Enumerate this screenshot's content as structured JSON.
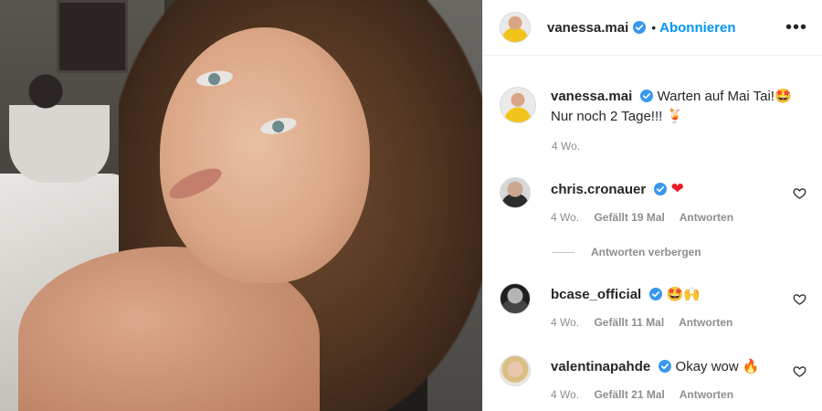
{
  "post": {
    "author": "vanessa.mai",
    "follow_label": "Abonnieren",
    "more_label": "•••",
    "caption_text_line1": "Warten auf Mai Tai!",
    "caption_emoji1": "🤩",
    "caption_text_line2": "Nur noch 2 Tage!!!",
    "caption_emoji2": "🍹",
    "caption_age": "4 Wo."
  },
  "comments": [
    {
      "user": "chris.cronauer",
      "text": "",
      "emoji": "❤",
      "age": "4 Wo.",
      "likes": "Gefällt 19 Mal",
      "reply": "Antworten"
    },
    {
      "user": "bcase_official",
      "text": "",
      "emoji": "🤩🙌",
      "age": "4 Wo.",
      "likes": "Gefällt 11 Mal",
      "reply": "Antworten"
    },
    {
      "user": "valentinapahde",
      "text": "Okay wow",
      "emoji": "🔥",
      "age": "4 Wo.",
      "likes": "Gefällt 21 Mal",
      "reply": "Antworten"
    }
  ],
  "hide_replies_label": "Antworten verbergen",
  "colors": {
    "link_blue": "#0095f6",
    "verified_blue": "#3897f0",
    "meta_gray": "#8e8e8e"
  },
  "icons": [
    "verified-badge-icon",
    "more-options-icon",
    "heart-outline-icon"
  ]
}
